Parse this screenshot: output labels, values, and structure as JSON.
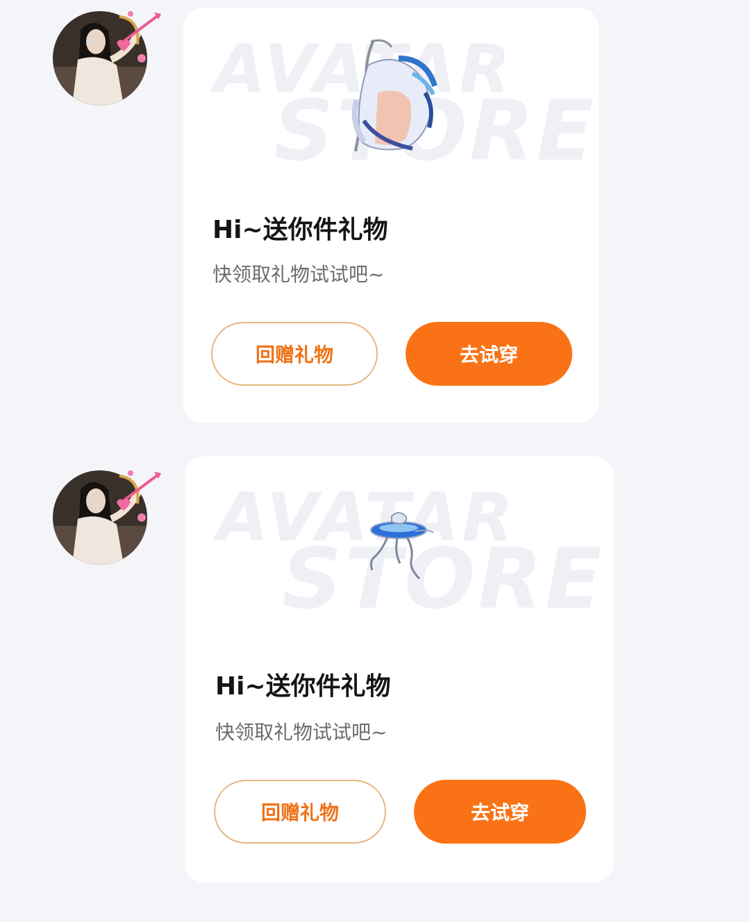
{
  "messages": [
    {
      "gift_card": {
        "watermark_line1": "AVATAR",
        "watermark_line2": "STORE",
        "item_icon": "avatar-hair-accessory-icon",
        "title": "Hi~送你件礼物",
        "subtitle": "快领取礼物试试吧~",
        "return_gift_label": "回赠礼物",
        "try_on_label": "去试穿"
      },
      "sender_avatar_icon": "user-avatar-with-cupid-bow"
    },
    {
      "gift_card": {
        "watermark_line1": "AVATAR",
        "watermark_line2": "STORE",
        "item_icon": "avatar-floating-jellyfish-icon",
        "title": "Hi~送你件礼物",
        "subtitle": "快领取礼物试试吧~",
        "return_gift_label": "回赠礼物",
        "try_on_label": "去试穿"
      },
      "sender_avatar_icon": "user-avatar-with-cupid-bow"
    }
  ],
  "colors": {
    "page_background": "#f4f5f9",
    "card_background": "#ffffff",
    "accent_orange": "#f97316",
    "outline_border": "#e7b57e",
    "title_text": "#151515",
    "subtitle_text": "#6b6b6b"
  }
}
